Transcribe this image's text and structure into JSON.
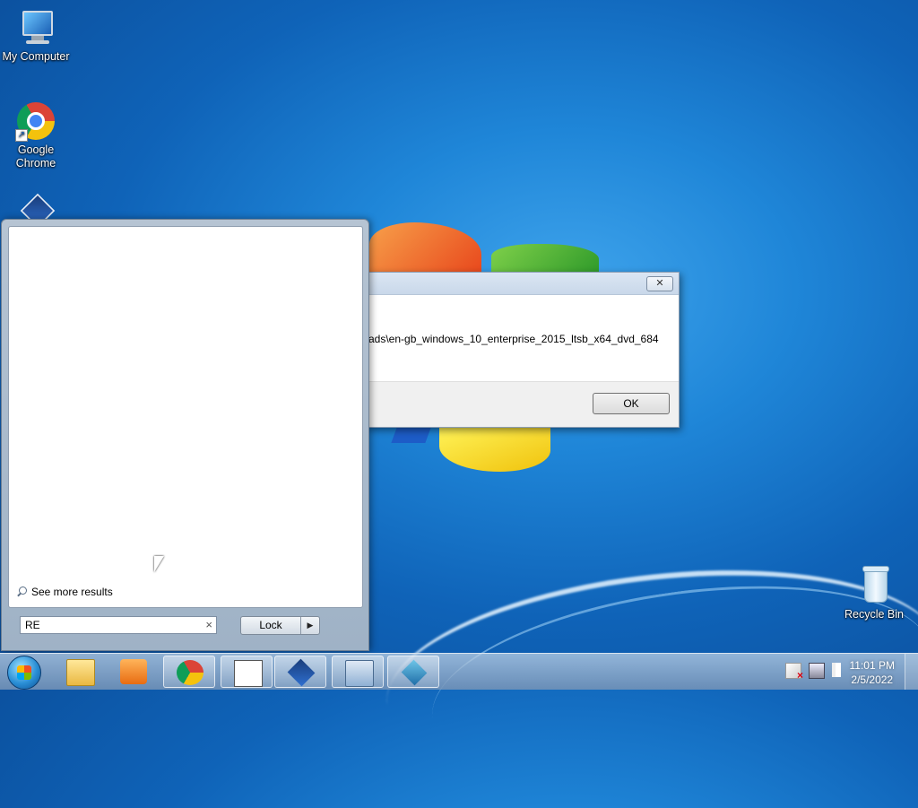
{
  "desktop": {
    "icons": {
      "my_computer": "My Computer",
      "google_chrome": "Google Chrome",
      "virtualbox": "",
      "recycle_bin": "Recycle Bin"
    }
  },
  "dialog": {
    "title": "",
    "close_label": "✕",
    "message": "ads\\en-gb_windows_10_enterprise_2015_ltsb_x64_dvd_684",
    "ok_label": "OK"
  },
  "start_menu": {
    "see_more": "See more results",
    "search_value": "RE",
    "clear_label": "×",
    "lock_label": "Lock",
    "lock_arrow": "▶"
  },
  "taskbar": {
    "pinned": [
      "start-orb",
      "explorer-icon",
      "media-player-icon",
      "chrome-icon",
      "notepadpp-icon",
      "virtualbox-icon",
      "remote-desktop-icon",
      "regedit-icon"
    ],
    "active": [
      "chrome-icon",
      "notepadpp-icon",
      "virtualbox-icon",
      "remote-desktop-icon",
      "regedit-icon"
    ]
  },
  "tray": {
    "icons": [
      "action-center-flag-icon",
      "network-icon",
      "volume-icon"
    ],
    "time": "11:01 PM",
    "date": "2/5/2022"
  }
}
